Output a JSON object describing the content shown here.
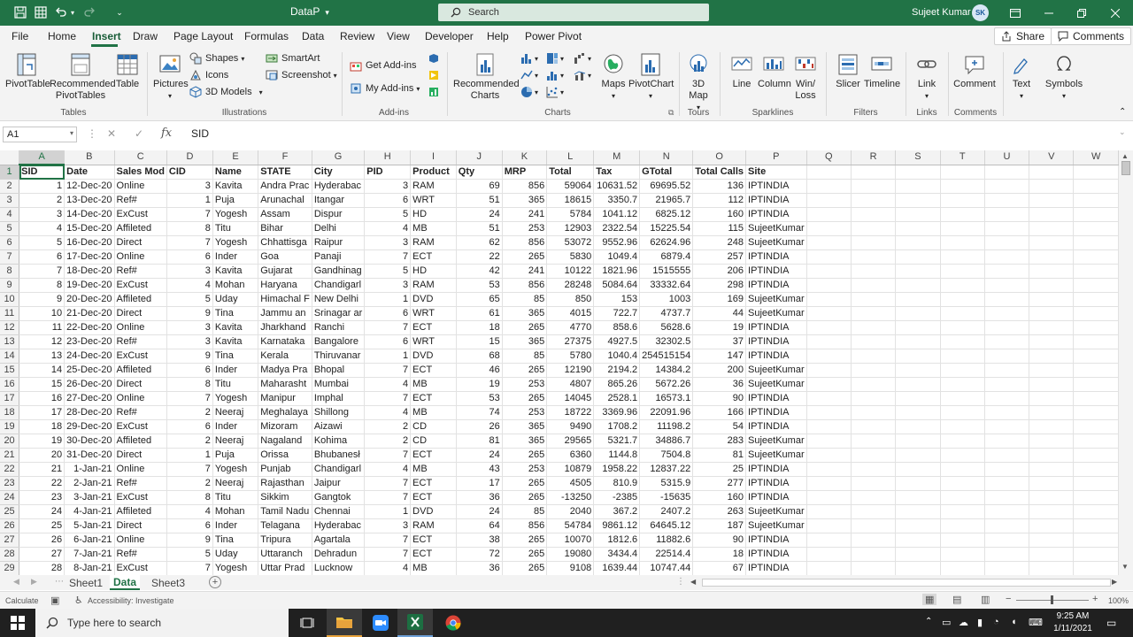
{
  "app": {
    "doc_title": "DataP",
    "search_placeholder": "Search",
    "user_name": "Sujeet Kumar",
    "user_initials": "SK",
    "accent": "#217346"
  },
  "tabs": [
    "File",
    "Home",
    "Insert",
    "Draw",
    "Page Layout",
    "Formulas",
    "Data",
    "Review",
    "View",
    "Developer",
    "Help",
    "Power Pivot"
  ],
  "active_tab": "Insert",
  "share_label": "Share",
  "comments_label": "Comments",
  "ribbon": {
    "pivottable": "PivotTable",
    "recommended_pivottables": "Recommended PivotTables",
    "table": "Table",
    "tables_group": "Tables",
    "pictures": "Pictures",
    "shapes": "Shapes",
    "icons": "Icons",
    "models3d": "3D Models",
    "smartart": "SmartArt",
    "screenshot": "Screenshot",
    "illustrations_group": "Illustrations",
    "get_addins": "Get Add-ins",
    "my_addins": "My Add-ins",
    "addins_group": "Add-ins",
    "recommended_charts": "Recommended Charts",
    "maps": "Maps",
    "pivotchart": "PivotChart",
    "charts_group": "Charts",
    "map3d": "3D Map",
    "tours_group": "Tours",
    "line": "Line",
    "column": "Column",
    "winloss": "Win/ Loss",
    "sparklines_group": "Sparklines",
    "slicer": "Slicer",
    "timeline": "Timeline",
    "filters_group": "Filters",
    "link": "Link",
    "links_group": "Links",
    "comment": "Comment",
    "comments_group": "Comments",
    "text": "Text",
    "symbols": "Symbols"
  },
  "formula_bar": {
    "name_box": "A1",
    "value": "SID"
  },
  "columns": [
    "A",
    "B",
    "C",
    "D",
    "E",
    "F",
    "G",
    "H",
    "I",
    "J",
    "K",
    "L",
    "M",
    "N",
    "O",
    "P",
    "Q",
    "R",
    "S",
    "T",
    "U",
    "V",
    "W"
  ],
  "headers": [
    "SID",
    "Date",
    "Sales Mod",
    "CID",
    "Name",
    "STATE",
    "City",
    "PID",
    "Product",
    "Qty",
    "MRP",
    "Total",
    "Tax",
    "GTotal",
    "Total Calls",
    "Site"
  ],
  "rows": [
    [
      "1",
      "12-Dec-20",
      "Online",
      "3",
      "Kavita",
      "Andra Prac",
      "Hyderabac",
      "3",
      "RAM",
      "69",
      "856",
      "59064",
      "10631.52",
      "69695.52",
      "136",
      "IPTINDIA"
    ],
    [
      "2",
      "13-Dec-20",
      "Ref#",
      "1",
      "Puja",
      "Arunachal",
      "Itangar",
      "6",
      "WRT",
      "51",
      "365",
      "18615",
      "3350.7",
      "21965.7",
      "112",
      "IPTINDIA"
    ],
    [
      "3",
      "14-Dec-20",
      "ExCust",
      "7",
      "Yogesh",
      "Assam",
      "Dispur",
      "5",
      "HD",
      "24",
      "241",
      "5784",
      "1041.12",
      "6825.12",
      "160",
      "IPTINDIA"
    ],
    [
      "4",
      "15-Dec-20",
      "Affileted",
      "8",
      "Titu",
      "Bihar",
      "Delhi",
      "4",
      "MB",
      "51",
      "253",
      "12903",
      "2322.54",
      "15225.54",
      "115",
      "SujeetKumar"
    ],
    [
      "5",
      "16-Dec-20",
      "Direct",
      "7",
      "Yogesh",
      "Chhattisga",
      "Raipur",
      "3",
      "RAM",
      "62",
      "856",
      "53072",
      "9552.96",
      "62624.96",
      "248",
      "SujeetKumar"
    ],
    [
      "6",
      "17-Dec-20",
      "Online",
      "6",
      "Inder",
      "Goa",
      "Panaji",
      "7",
      "ECT",
      "22",
      "265",
      "5830",
      "1049.4",
      "6879.4",
      "257",
      "IPTINDIA"
    ],
    [
      "7",
      "18-Dec-20",
      "Ref#",
      "3",
      "Kavita",
      "Gujarat",
      "Gandhinag",
      "5",
      "HD",
      "42",
      "241",
      "10122",
      "1821.96",
      "1515555",
      "206",
      "IPTINDIA"
    ],
    [
      "8",
      "19-Dec-20",
      "ExCust",
      "4",
      "Mohan",
      "Haryana",
      "Chandigarl",
      "3",
      "RAM",
      "53",
      "856",
      "28248",
      "5084.64",
      "33332.64",
      "298",
      "IPTINDIA"
    ],
    [
      "9",
      "20-Dec-20",
      "Affileted",
      "5",
      "Uday",
      "Himachal F",
      "New Delhi",
      "1",
      "DVD",
      "65",
      "85",
      "850",
      "153",
      "1003",
      "169",
      "SujeetKumar"
    ],
    [
      "10",
      "21-Dec-20",
      "Direct",
      "9",
      "Tina",
      "Jammu an",
      "Srinagar ar",
      "6",
      "WRT",
      "61",
      "365",
      "4015",
      "722.7",
      "4737.7",
      "44",
      "SujeetKumar"
    ],
    [
      "11",
      "22-Dec-20",
      "Online",
      "3",
      "Kavita",
      "Jharkhand",
      "Ranchi",
      "7",
      "ECT",
      "18",
      "265",
      "4770",
      "858.6",
      "5628.6",
      "19",
      "IPTINDIA"
    ],
    [
      "12",
      "23-Dec-20",
      "Ref#",
      "3",
      "Kavita",
      "Karnataka",
      "Bangalore",
      "6",
      "WRT",
      "15",
      "365",
      "27375",
      "4927.5",
      "32302.5",
      "37",
      "IPTINDIA"
    ],
    [
      "13",
      "24-Dec-20",
      "ExCust",
      "9",
      "Tina",
      "Kerala",
      "Thiruvanar",
      "1",
      "DVD",
      "68",
      "85",
      "5780",
      "1040.4",
      "254515154",
      "147",
      "IPTINDIA"
    ],
    [
      "14",
      "25-Dec-20",
      "Affileted",
      "6",
      "Inder",
      "Madya Pra",
      "Bhopal",
      "7",
      "ECT",
      "46",
      "265",
      "12190",
      "2194.2",
      "14384.2",
      "200",
      "SujeetKumar"
    ],
    [
      "15",
      "26-Dec-20",
      "Direct",
      "8",
      "Titu",
      "Maharasht",
      "Mumbai",
      "4",
      "MB",
      "19",
      "253",
      "4807",
      "865.26",
      "5672.26",
      "36",
      "SujeetKumar"
    ],
    [
      "16",
      "27-Dec-20",
      "Online",
      "7",
      "Yogesh",
      "Manipur",
      "Imphal",
      "7",
      "ECT",
      "53",
      "265",
      "14045",
      "2528.1",
      "16573.1",
      "90",
      "IPTINDIA"
    ],
    [
      "17",
      "28-Dec-20",
      "Ref#",
      "2",
      "Neeraj",
      "Meghalaya",
      "Shillong",
      "4",
      "MB",
      "74",
      "253",
      "18722",
      "3369.96",
      "22091.96",
      "166",
      "IPTINDIA"
    ],
    [
      "18",
      "29-Dec-20",
      "ExCust",
      "6",
      "Inder",
      "Mizoram",
      "Aizawi",
      "2",
      "CD",
      "26",
      "365",
      "9490",
      "1708.2",
      "11198.2",
      "54",
      "IPTINDIA"
    ],
    [
      "19",
      "30-Dec-20",
      "Affileted",
      "2",
      "Neeraj",
      "Nagaland",
      "Kohima",
      "2",
      "CD",
      "81",
      "365",
      "29565",
      "5321.7",
      "34886.7",
      "283",
      "SujeetKumar"
    ],
    [
      "20",
      "31-Dec-20",
      "Direct",
      "1",
      "Puja",
      "Orissa",
      "Bhubanesł",
      "7",
      "ECT",
      "24",
      "265",
      "6360",
      "1144.8",
      "7504.8",
      "81",
      "SujeetKumar"
    ],
    [
      "21",
      "1-Jan-21",
      "Online",
      "7",
      "Yogesh",
      "Punjab",
      "Chandigarl",
      "4",
      "MB",
      "43",
      "253",
      "10879",
      "1958.22",
      "12837.22",
      "25",
      "IPTINDIA"
    ],
    [
      "22",
      "2-Jan-21",
      "Ref#",
      "2",
      "Neeraj",
      "Rajasthan",
      "Jaipur",
      "7",
      "ECT",
      "17",
      "265",
      "4505",
      "810.9",
      "5315.9",
      "277",
      "IPTINDIA"
    ],
    [
      "23",
      "3-Jan-21",
      "ExCust",
      "8",
      "Titu",
      "Sikkim",
      "Gangtok",
      "7",
      "ECT",
      "36",
      "265",
      "-13250",
      "-2385",
      "-15635",
      "160",
      "IPTINDIA"
    ],
    [
      "24",
      "4-Jan-21",
      "Affileted",
      "4",
      "Mohan",
      "Tamil Nadu",
      "Chennai",
      "1",
      "DVD",
      "24",
      "85",
      "2040",
      "367.2",
      "2407.2",
      "263",
      "SujeetKumar"
    ],
    [
      "25",
      "5-Jan-21",
      "Direct",
      "6",
      "Inder",
      "Telagana",
      "Hyderabac",
      "3",
      "RAM",
      "64",
      "856",
      "54784",
      "9861.12",
      "64645.12",
      "187",
      "SujeetKumar"
    ],
    [
      "26",
      "6-Jan-21",
      "Online",
      "9",
      "Tina",
      "Tripura",
      "Agartala",
      "7",
      "ECT",
      "38",
      "265",
      "10070",
      "1812.6",
      "11882.6",
      "90",
      "IPTINDIA"
    ],
    [
      "27",
      "7-Jan-21",
      "Ref#",
      "5",
      "Uday",
      "Uttaranch",
      "Dehradun",
      "7",
      "ECT",
      "72",
      "265",
      "19080",
      "3434.4",
      "22514.4",
      "18",
      "IPTINDIA"
    ],
    [
      "28",
      "8-Jan-21",
      "ExCust",
      "7",
      "Yogesh",
      "Uttar Prad",
      "Lucknow",
      "4",
      "MB",
      "36",
      "265",
      "9108",
      "1639.44",
      "10747.44",
      "67",
      "IPTINDIA"
    ]
  ],
  "sheets": [
    "Sheet1",
    "Data",
    "Sheet3"
  ],
  "active_sheet": "Data",
  "status": {
    "mode": "Calculate",
    "accessibility": "Accessibility: Investigate",
    "zoom": "100%"
  },
  "taskbar": {
    "search_placeholder": "Type here to search",
    "time": "9:25 AM",
    "date": "1/11/2021"
  }
}
